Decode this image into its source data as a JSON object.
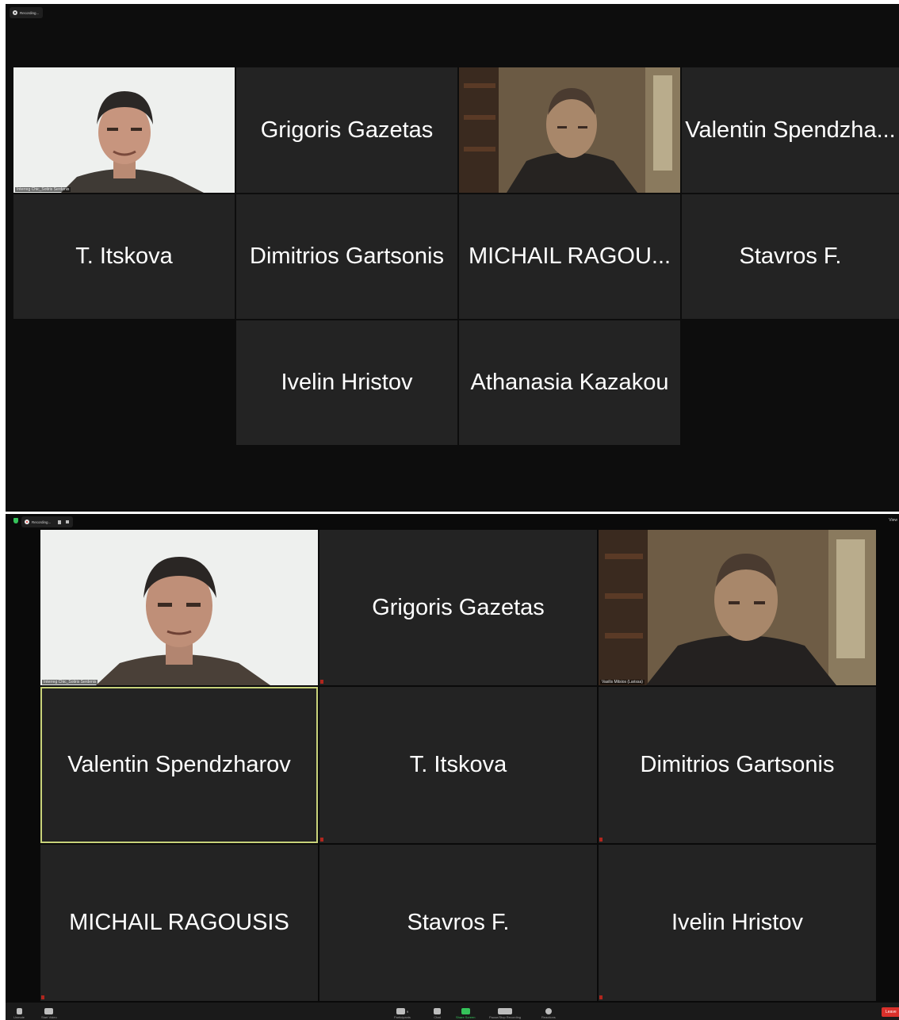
{
  "top": {
    "recording_label": "Recording...",
    "tiles": [
      {
        "name": "Interreg Chic_Sotiris Serdenis"
      },
      {
        "name": "Grigoris Gazetas"
      },
      {
        "name": ""
      },
      {
        "name": "Valentin Spendzha..."
      },
      {
        "name": "T. Itskova"
      },
      {
        "name": "Dimitrios Gartsonis"
      },
      {
        "name": "MICHAIL RAGOU..."
      },
      {
        "name": "Stavros F."
      },
      {
        "name": "Ivelin Hristov"
      },
      {
        "name": "Athanasia Kazakou"
      }
    ]
  },
  "bottom": {
    "recording_label": "Recording...",
    "view_label": "View",
    "tiles": [
      {
        "name": "Interreg Chic_Sotiris Serdenis"
      },
      {
        "name": "Grigoris Gazetas"
      },
      {
        "name": "Vasilis Mitsios (Larissa)"
      },
      {
        "name": "Valentin Spendzharov"
      },
      {
        "name": "T. Itskova"
      },
      {
        "name": "Dimitrios Gartsonis"
      },
      {
        "name": "MICHAIL RAGOUSIS"
      },
      {
        "name": "Stavros F."
      },
      {
        "name": "Ivelin Hristov"
      }
    ],
    "toolbar": {
      "unmute": "Unmute",
      "start_video": "Start Video",
      "participants": "Participants",
      "participants_count": "9",
      "chat": "Chat",
      "share_screen": "Share Screen",
      "pause_stop_recording": "Pause/Stop Recording",
      "reactions": "Reactions",
      "leave": "Leave"
    }
  },
  "colors": {
    "tile_bg": "#232323",
    "active_speaker_border": "#c8d27a",
    "share_green": "#35c35a",
    "leave_red": "#d9302b"
  }
}
